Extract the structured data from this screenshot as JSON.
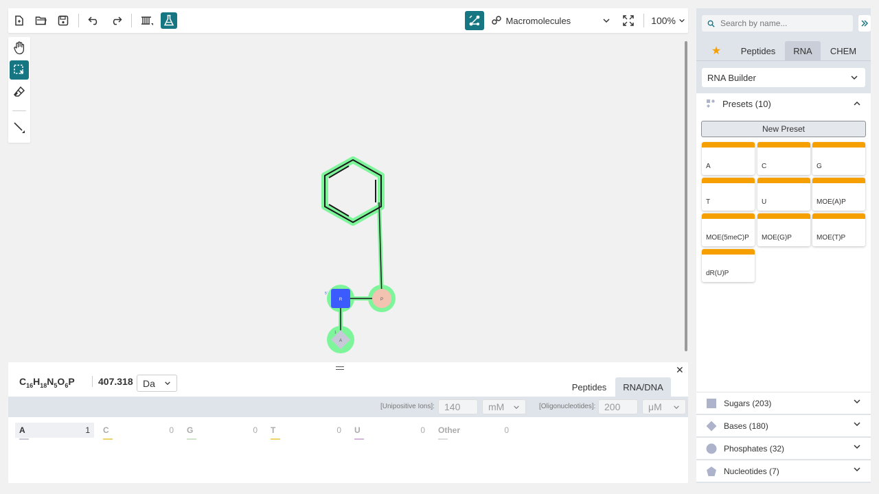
{
  "toolbar": {
    "mode_label": "Macromolecules",
    "zoom": "100%"
  },
  "canvas": {
    "monomers": [
      {
        "symbol": "R",
        "type": "sugar",
        "color": "#3b5bff"
      },
      {
        "symbol": "P",
        "type": "phosphate",
        "color": "#f2c3b0"
      },
      {
        "symbol": "A",
        "type": "base",
        "color": "#c7c9d9"
      }
    ],
    "chain_marker_5": "5'",
    "chain_marker_1": "1",
    "highlight_color": "#7ef59a"
  },
  "bottom": {
    "formula_parts": [
      {
        "el": "C",
        "n": "16"
      },
      {
        "el": "H",
        "n": "18"
      },
      {
        "el": "N",
        "n": "5"
      },
      {
        "el": "O",
        "n": "6"
      },
      {
        "el": "P",
        "n": ""
      }
    ],
    "mass": "407.318",
    "mass_unit": "Da",
    "tabs": [
      "Peptides",
      "RNA/DNA"
    ],
    "unipositive_label": "[Unipositive Ions]:",
    "unipositive_value": "140",
    "unipositive_unit": "mM",
    "oligo_label": "[Oligonucleotides]:",
    "oligo_value": "200",
    "oligo_unit": "μM",
    "counts": [
      {
        "label": "A",
        "value": "1",
        "color": "#c7c9d9"
      },
      {
        "label": "C",
        "value": "0",
        "color": "#f1d36b"
      },
      {
        "label": "G",
        "value": "0",
        "color": "#cfe3c8"
      },
      {
        "label": "T",
        "value": "0",
        "color": "#f1d36b"
      },
      {
        "label": "U",
        "value": "0",
        "color": "#d6b6df"
      },
      {
        "label": "Other",
        "value": "0",
        "color": "#dddddd"
      }
    ]
  },
  "library": {
    "search_placeholder": "Search by name...",
    "tabs": [
      "Peptides",
      "RNA",
      "CHEM"
    ],
    "builder_label": "RNA Builder",
    "presets_label": "Presets (10)",
    "new_preset": "New Preset",
    "presets": [
      "A",
      "C",
      "G",
      "T",
      "U",
      "MOE(A)P",
      "MOE(5meC)P",
      "MOE(G)P",
      "MOE(T)P",
      "dR(U)P"
    ],
    "sections": [
      {
        "label": "Sugars (203)",
        "icon": "square-icon"
      },
      {
        "label": "Bases (180)",
        "icon": "diamond-icon"
      },
      {
        "label": "Phosphates (32)",
        "icon": "circle-icon"
      },
      {
        "label": "Nucleotides (7)",
        "icon": "pentagon-icon"
      }
    ],
    "accent": "#167782",
    "preset_color": "#f5a000"
  }
}
